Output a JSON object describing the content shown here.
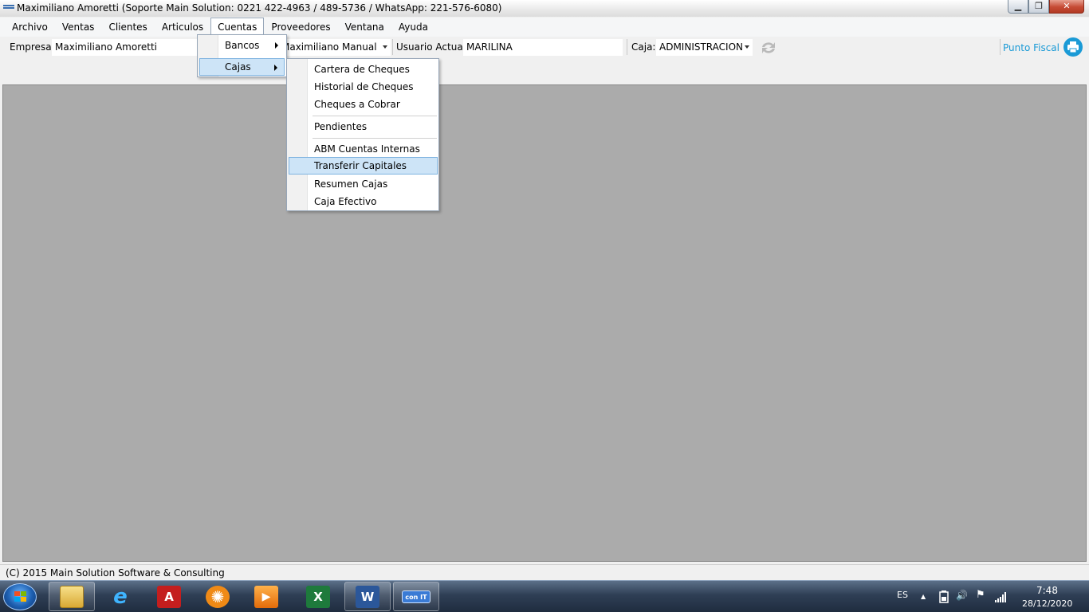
{
  "window": {
    "title": "Maximiliano Amoretti (Soporte Main Solution: 0221 422-4963 / 489-5736 / WhatsApp: 221-576-6080)",
    "min_glyph": "▁",
    "max_glyph": "❐",
    "close_glyph": "✕"
  },
  "menubar": {
    "items": [
      "Archivo",
      "Ventas",
      "Clientes",
      "Articulos",
      "Cuentas",
      "Proveedores",
      "Ventana",
      "Ayuda"
    ],
    "open_item": "Cuentas"
  },
  "infobar": {
    "empresa_label": "Empresa:",
    "empresa_value": "Maximiliano Amoretti",
    "vendedor_value": "Maximiliano Manual",
    "usuario_label": "Usuario Actual:",
    "usuario_value": "MARILINA",
    "caja_label": "Caja:",
    "caja_value": "ADMINISTRACION",
    "punto_fiscal": "Punto Fiscal"
  },
  "cuentas_menu": {
    "items": [
      {
        "label": "Bancos",
        "has_submenu": true
      },
      {
        "label": "Cajas",
        "has_submenu": true,
        "highlighted": true
      }
    ]
  },
  "cajas_submenu": {
    "items": [
      {
        "label": "Cartera de Cheques"
      },
      {
        "label": "Historial de Cheques"
      },
      {
        "label": "Cheques a Cobrar"
      },
      {
        "label": "Pendientes"
      },
      {
        "label": "ABM Cuentas Internas"
      },
      {
        "label": "Transferir Capitales",
        "highlighted": true
      },
      {
        "label": "Resumen Cajas"
      },
      {
        "label": "Caja Efectivo"
      }
    ]
  },
  "statusbar": {
    "text": "(C) 2015 Main Solution Software & Consulting"
  },
  "taskbar": {
    "apps": [
      {
        "name": "explorer",
        "icon": "folder-icon"
      },
      {
        "name": "internet-explorer",
        "icon": "ie-icon",
        "glyph": "e"
      },
      {
        "name": "autocad",
        "icon": "autocad-icon",
        "glyph": "A"
      },
      {
        "name": "settings",
        "icon": "gear-icon",
        "glyph": "✺"
      },
      {
        "name": "media-player",
        "icon": "media-player-icon",
        "glyph": "▶"
      },
      {
        "name": "excel",
        "icon": "excel-icon",
        "glyph": "X"
      },
      {
        "name": "word",
        "icon": "word-icon",
        "glyph": "W"
      },
      {
        "name": "main-solution",
        "icon": "app-window-icon",
        "glyph": "con IT"
      }
    ],
    "language": "ES",
    "tray_up_glyph": "▲",
    "volume_glyph": "🔊",
    "flag_glyph": "⚑",
    "time": "7:48",
    "date": "28/12/2020"
  },
  "colors": {
    "accent": "#1a9ad6",
    "mdi_background": "#ababab",
    "menu_highlight": "#cde4f7"
  }
}
